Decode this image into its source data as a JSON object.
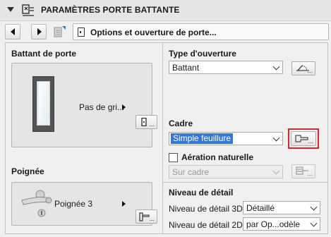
{
  "header": {
    "title": "PARAMÈTRES PORTE BATTANTE"
  },
  "toolbar": {
    "dropdown_label": "Options et ouverture de porte..."
  },
  "left": {
    "door_section_title": "Battant de porte",
    "door_preview_label": "Pas de gri...",
    "handle_section_title": "Poignée",
    "handle_preview_label": "Poignée 3"
  },
  "right": {
    "opening_type_title": "Type d'ouverture",
    "opening_type_value": "Battant",
    "frame_title": "Cadre",
    "frame_value": "Simple feuillure",
    "ventilation_label": "Aération naturelle",
    "ventilation_checked": false,
    "ventilation_position_value": "Sur cadre",
    "detail_title": "Niveau de détail",
    "detail_3d_label": "Niveau de détail 3D",
    "detail_3d_value": "Détaillé",
    "detail_2d_label": "Niveau de détail 2D",
    "detail_2d_value": "par Op...odèle"
  },
  "icons": {
    "ellipsis": "..."
  },
  "colors": {
    "highlight": "#e0232e",
    "selection": "#3478d4"
  }
}
